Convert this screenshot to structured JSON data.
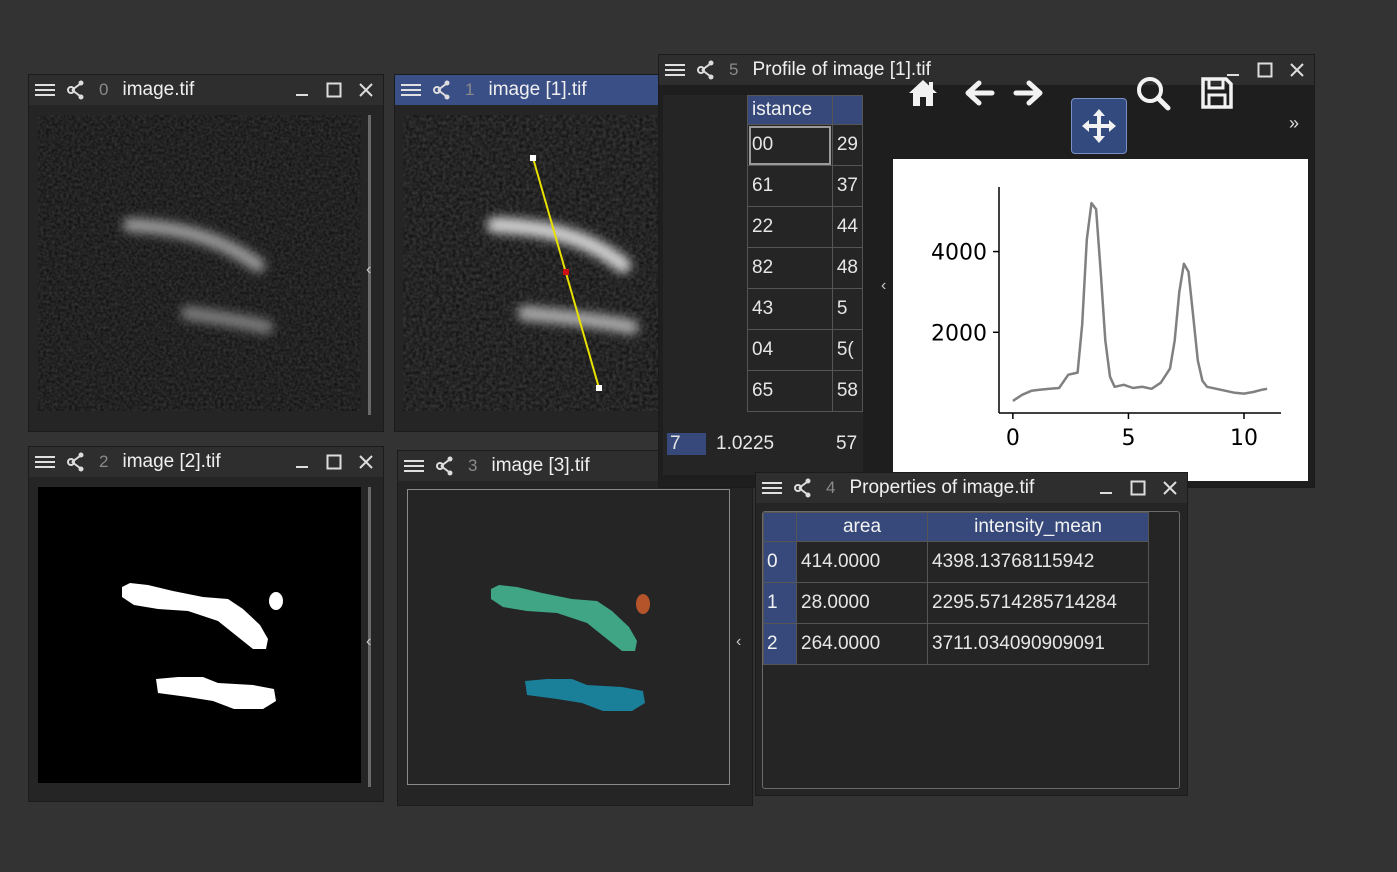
{
  "windows": {
    "w0": {
      "index": "0",
      "title": "image.tif"
    },
    "w1": {
      "index": "1",
      "title": "image [1].tif"
    },
    "w2": {
      "index": "2",
      "title": "image [2].tif"
    },
    "w3": {
      "index": "3",
      "title": "image [3].tif"
    },
    "w4": {
      "index": "4",
      "title": "Properties of image.tif"
    },
    "w5": {
      "index": "5",
      "title": "Profile of image [1].tif"
    }
  },
  "profile_table": {
    "header": "istance",
    "rows": [
      {
        "a": "00",
        "b": "29"
      },
      {
        "a": "61",
        "b": "37"
      },
      {
        "a": "22",
        "b": "44"
      },
      {
        "a": "82",
        "b": "48"
      },
      {
        "a": "43",
        "b": "5"
      },
      {
        "a": "04",
        "b": "5("
      },
      {
        "a": "65",
        "b": "58"
      }
    ],
    "last_row": {
      "index": "7",
      "a": "1.0225",
      "b": "57"
    }
  },
  "toolbar": {
    "icons": [
      "home-icon",
      "back-arrow-icon",
      "forward-arrow-icon",
      "pan-icon",
      "zoom-icon",
      "save-icon"
    ],
    "more": "»"
  },
  "chart_data": {
    "type": "line",
    "title": "",
    "xlabel": "",
    "ylabel": "",
    "xlim": [
      -0.6,
      11.6
    ],
    "ylim": [
      0,
      5600
    ],
    "xticks": [
      "0",
      "5",
      "10"
    ],
    "yticks": [
      "2000",
      "4000"
    ],
    "series": [
      {
        "color": "#808080",
        "x": [
          0,
          0.4,
          0.8,
          1.2,
          1.6,
          2.0,
          2.4,
          2.8,
          3.0,
          3.2,
          3.4,
          3.6,
          3.8,
          4.0,
          4.2,
          4.4,
          4.8,
          5.2,
          5.6,
          6.0,
          6.4,
          6.8,
          7.0,
          7.2,
          7.4,
          7.6,
          7.8,
          8.0,
          8.2,
          8.4,
          8.8,
          9.2,
          9.6,
          10.0,
          10.4,
          10.8,
          11.0
        ],
        "y": [
          300,
          450,
          550,
          580,
          600,
          620,
          950,
          1000,
          2200,
          4300,
          5200,
          5050,
          3500,
          1800,
          900,
          650,
          700,
          620,
          650,
          600,
          750,
          1100,
          1800,
          3000,
          3700,
          3500,
          2400,
          1300,
          800,
          650,
          600,
          550,
          500,
          480,
          520,
          580,
          600
        ]
      }
    ]
  },
  "properties_table": {
    "columns": [
      "area",
      "intensity_mean"
    ],
    "rows": [
      {
        "index": "0",
        "area": "414.0000",
        "intensity_mean": "4398.13768115942"
      },
      {
        "index": "1",
        "area": "28.0000",
        "intensity_mean": "2295.5714285714284"
      },
      {
        "index": "2",
        "area": "264.0000",
        "intensity_mean": "3711.034090909091"
      }
    ]
  },
  "colors": {
    "desktop": "#333333",
    "active_title": "#3a4f86",
    "label_green": "#3fa584",
    "label_teal": "#1a7f98",
    "label_orange": "#b5542a",
    "line_roi": "#e8e000"
  }
}
